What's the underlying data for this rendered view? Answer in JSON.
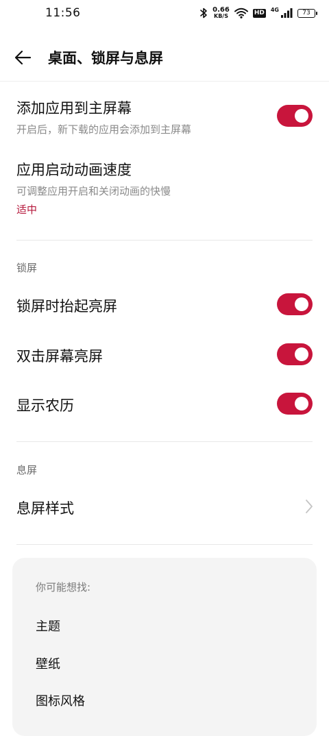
{
  "status_bar": {
    "time": "11:56",
    "net_speed_value": "0.66",
    "net_speed_unit": "KB/S",
    "hd_label": "HD",
    "network_label": "4G",
    "battery_level": "73",
    "icons": [
      "bluetooth-icon",
      "wifi-icon",
      "signal-icon",
      "battery-icon"
    ]
  },
  "header": {
    "title": "桌面、锁屏与息屏"
  },
  "desktop_settings": {
    "add_to_home": {
      "title": "添加应用到主屏幕",
      "subtitle": "开启后，新下载的应用会添加到主屏幕",
      "enabled": true
    },
    "anim_speed": {
      "title": "应用启动动画速度",
      "subtitle": "可调整应用开启和关闭动画的快慢",
      "value": "适中"
    }
  },
  "lock_screen": {
    "section_title": "锁屏",
    "raise_to_wake": {
      "title": "锁屏时抬起亮屏",
      "enabled": true
    },
    "double_tap_wake": {
      "title": "双击屏幕亮屏",
      "enabled": true
    },
    "lunar_calendar": {
      "title": "显示农历",
      "enabled": true
    }
  },
  "screen_off": {
    "section_title": "息屏",
    "style": {
      "title": "息屏样式"
    }
  },
  "suggestions": {
    "heading": "你可能想找:",
    "items": [
      "主题",
      "壁纸",
      "图标风格"
    ]
  },
  "colors": {
    "accent": "#c8153c",
    "accent_text": "#b5173b",
    "card_bg": "#f4f4f4"
  }
}
